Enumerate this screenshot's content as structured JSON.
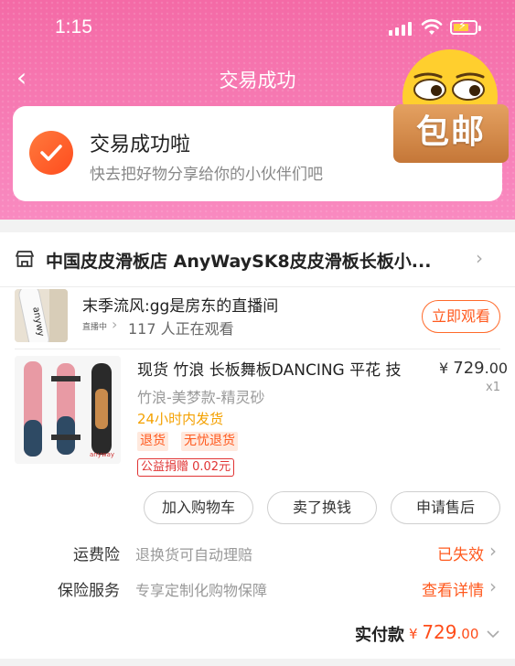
{
  "status_bar": {
    "time": "1:15"
  },
  "nav": {
    "back_icon": "‹",
    "title": "交易成功"
  },
  "success": {
    "title": "交易成功啦",
    "subtitle": "快去把好物分享给你的小伙伴们吧"
  },
  "promo_badge": {
    "text": "包邮"
  },
  "shop": {
    "name": "中国皮皮滑板店 AnyWaySK8皮皮滑板长板小..."
  },
  "live": {
    "title": "末季流风:gg是房东的直播间",
    "tag": "直播中",
    "viewers": "117 人正在观看",
    "watch_button": "立即观看"
  },
  "product": {
    "title": "现货 竹浪 长板舞板DANCING 平花 技",
    "price_symbol": "¥",
    "price_int": "729",
    "price_dec": ".00",
    "quantity": "x1",
    "sku": "竹浪-美梦款-精灵砂",
    "shipping": "24小时内发货",
    "tags": [
      "退货",
      "无忧退货"
    ],
    "donation": "公益捐赠 0.02元"
  },
  "actions": {
    "add_to_cart": "加入购物车",
    "resell": "卖了换钱",
    "after_sale": "申请售后"
  },
  "shipping_insurance": {
    "label": "运费险",
    "desc": "退换货可自动理赔",
    "status": "已失效"
  },
  "protection": {
    "label": "保险服务",
    "desc": "专享定制化购物保障",
    "link": "查看详情"
  },
  "total": {
    "label": "实付款",
    "symbol": "¥",
    "amount_int": "729",
    "amount_dec": ".00"
  },
  "colors": {
    "accent": "#ff5a1f",
    "header_pink": "#f46aa6",
    "donate_red": "#e03434",
    "ship_yellow": "#f4a100"
  }
}
